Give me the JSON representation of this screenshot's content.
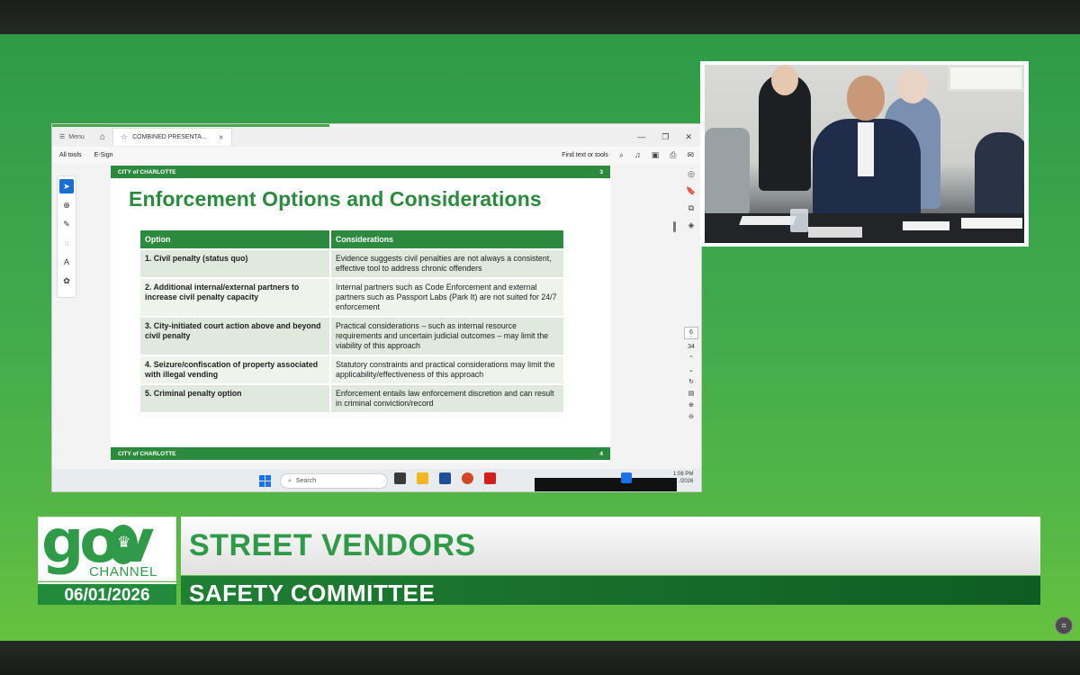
{
  "pdf_window": {
    "menu_label": "Menu",
    "tab_label": "COMBINED PRESENTA...",
    "toolbar": {
      "all_tools": "All tools",
      "e_sign": "E-Sign",
      "find": "Find text or tools"
    }
  },
  "slide": {
    "org_label": "CITY of CHARLOTTE",
    "page_top": "3",
    "page_bottom": "4",
    "title": "Enforcement Options and Considerations",
    "headers": [
      "Option",
      "Considerations"
    ],
    "rows": [
      {
        "option": "1.  Civil penalty (status quo)",
        "consideration": "Evidence suggests civil penalties are not always a consistent, effective tool to address chronic offenders"
      },
      {
        "option": "2.  Additional internal/external partners to increase civil penalty capacity",
        "consideration": "Internal partners such as Code Enforcement and external partners such as Passport Labs (Park It) are not suited for 24/7 enforcement"
      },
      {
        "option": "3.  City-initiated court action above and beyond civil penalty",
        "consideration": "Practical considerations – such as internal resource requirements and uncertain judicial outcomes – may limit the viability of this approach"
      },
      {
        "option": "4.  Seizure/confiscation of property associated with illegal vending",
        "consideration": "Statutory constraints and practical considerations may limit the applicability/effectiveness of this approach"
      },
      {
        "option": "5.  Criminal penalty option",
        "consideration": "Enforcement entails law enforcement discretion and can result in criminal conviction/record"
      }
    ]
  },
  "pager": {
    "current": "6",
    "total": "34"
  },
  "taskbar": {
    "search_placeholder": "Search",
    "time": "1:08 PM",
    "date": "/2026"
  },
  "broadcast": {
    "logo_text": "gov",
    "channel": "CHANNEL",
    "date": "06/01/2026",
    "title": "STREET VENDORS",
    "subtitle": "SAFETY COMMITTEE"
  },
  "colors": {
    "brand_green": "#2b8a3e",
    "banner_dark_green": "#0f5c22"
  }
}
